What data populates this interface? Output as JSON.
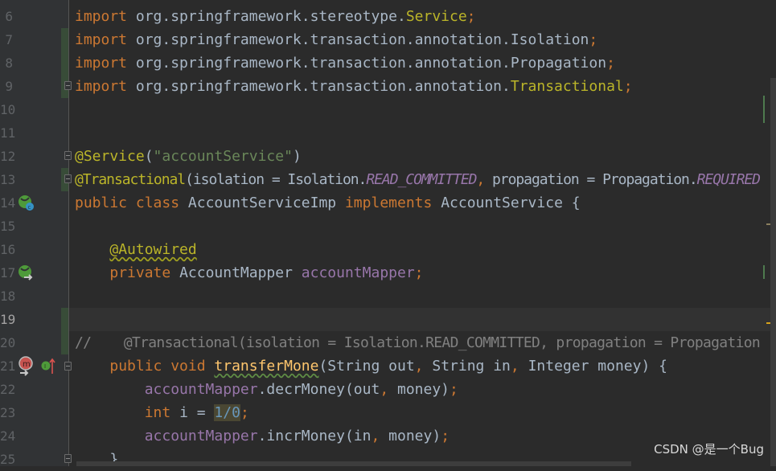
{
  "editor": {
    "current_line": 19,
    "lines": [
      {
        "n": "6",
        "tokens": [
          [
            "import ",
            "kw"
          ],
          [
            "org.springframework.stereotype.",
            "tx"
          ],
          [
            "Service",
            "an"
          ],
          [
            ";",
            "kw"
          ]
        ]
      },
      {
        "n": "7",
        "tokens": [
          [
            "import ",
            "kw"
          ],
          [
            "org.springframework.transaction.annotation.Isolation",
            "tx"
          ],
          [
            ";",
            "kw"
          ]
        ]
      },
      {
        "n": "8",
        "tokens": [
          [
            "import ",
            "kw"
          ],
          [
            "org.springframework.transaction.annotation.Propagation",
            "tx"
          ],
          [
            ";",
            "kw"
          ]
        ]
      },
      {
        "n": "9",
        "tokens": [
          [
            "import ",
            "kw"
          ],
          [
            "org.springframework.transaction.annotation.",
            "tx"
          ],
          [
            "Transactional",
            "an"
          ],
          [
            ";",
            "kw"
          ]
        ]
      },
      {
        "n": "10",
        "tokens": []
      },
      {
        "n": "11",
        "tokens": []
      },
      {
        "n": "12",
        "tokens": [
          [
            "@Service",
            "an"
          ],
          [
            "(",
            "tx"
          ],
          [
            "\"accountService\"",
            "st"
          ],
          [
            ")",
            "tx"
          ]
        ]
      },
      {
        "n": "13",
        "tokens": [
          [
            "@Transactional",
            "an"
          ],
          [
            "(",
            "tx"
          ],
          [
            "isolation",
            "tx"
          ],
          [
            " = Isolation.",
            "tx"
          ],
          [
            "READ_COMMITTED",
            "fdi"
          ],
          [
            ", ",
            "kw"
          ],
          [
            "propagation = Propagation.",
            "tx"
          ],
          [
            "REQUIRED",
            "fdi"
          ]
        ]
      },
      {
        "n": "14",
        "tokens": [
          [
            "public class ",
            "kw"
          ],
          [
            "AccountServiceImp ",
            "tx"
          ],
          [
            "implements ",
            "kw"
          ],
          [
            "AccountService {",
            "tx"
          ]
        ]
      },
      {
        "n": "15",
        "tokens": []
      },
      {
        "n": "16",
        "tokens": [
          [
            "    ",
            "tx"
          ],
          [
            "@Autowired",
            "an wavy"
          ]
        ]
      },
      {
        "n": "17",
        "tokens": [
          [
            "    ",
            "tx"
          ],
          [
            "private ",
            "kw"
          ],
          [
            "AccountMapper ",
            "tx"
          ],
          [
            "accountMapper",
            "fd"
          ],
          [
            ";",
            "kw"
          ]
        ]
      },
      {
        "n": "18",
        "tokens": []
      },
      {
        "n": "19",
        "tokens": []
      },
      {
        "n": "20",
        "tokens": [
          [
            "//    @Transactional(isolation = Isolation.READ_COMMITTED, propagation = Propagation",
            "cm"
          ]
        ]
      },
      {
        "n": "21",
        "tokens": [
          [
            "    ",
            "tx"
          ],
          [
            "public void ",
            "kw"
          ],
          [
            "transferMone",
            "md wavyg"
          ],
          [
            "(String out",
            "tx"
          ],
          [
            ", ",
            "kw"
          ],
          [
            "String in",
            "tx"
          ],
          [
            ", ",
            "kw"
          ],
          [
            "Integer money) {",
            "tx"
          ]
        ]
      },
      {
        "n": "22",
        "tokens": [
          [
            "        ",
            "tx"
          ],
          [
            "accountMapper",
            "fd"
          ],
          [
            ".decrMoney(out",
            "tx"
          ],
          [
            ", ",
            "kw"
          ],
          [
            "money)",
            "tx"
          ],
          [
            ";",
            "kw"
          ]
        ]
      },
      {
        "n": "23",
        "tokens": [
          [
            "        ",
            "tx"
          ],
          [
            "int ",
            "kw"
          ],
          [
            "i = ",
            "tx"
          ],
          [
            "1/0",
            "nu"
          ],
          [
            ";",
            "kw"
          ]
        ]
      },
      {
        "n": "24",
        "tokens": [
          [
            "        ",
            "tx"
          ],
          [
            "accountMapper",
            "fd"
          ],
          [
            ".incrMoney(in",
            "tx"
          ],
          [
            ", ",
            "kw"
          ],
          [
            "money)",
            "tx"
          ],
          [
            ";",
            "kw"
          ]
        ]
      },
      {
        "n": "25",
        "tokens": [
          [
            "    }",
            "tx"
          ]
        ]
      }
    ]
  },
  "gutter_icons": {
    "line_14": "spring-bean-class-icon",
    "line_17": "spring-autowired-navigate-icon",
    "line_21": [
      "transactional-method-icon",
      "implements-method-icon"
    ]
  },
  "watermark": "CSDN @是一个Bug",
  "colors": {
    "background": "#2b2b2b",
    "gutter": "#313335",
    "keyword": "#cc7832",
    "annotation": "#bbb529",
    "string": "#6a8759",
    "field": "#9876aa",
    "method": "#ffc66d",
    "comment": "#808080",
    "number": "#6897bb"
  }
}
